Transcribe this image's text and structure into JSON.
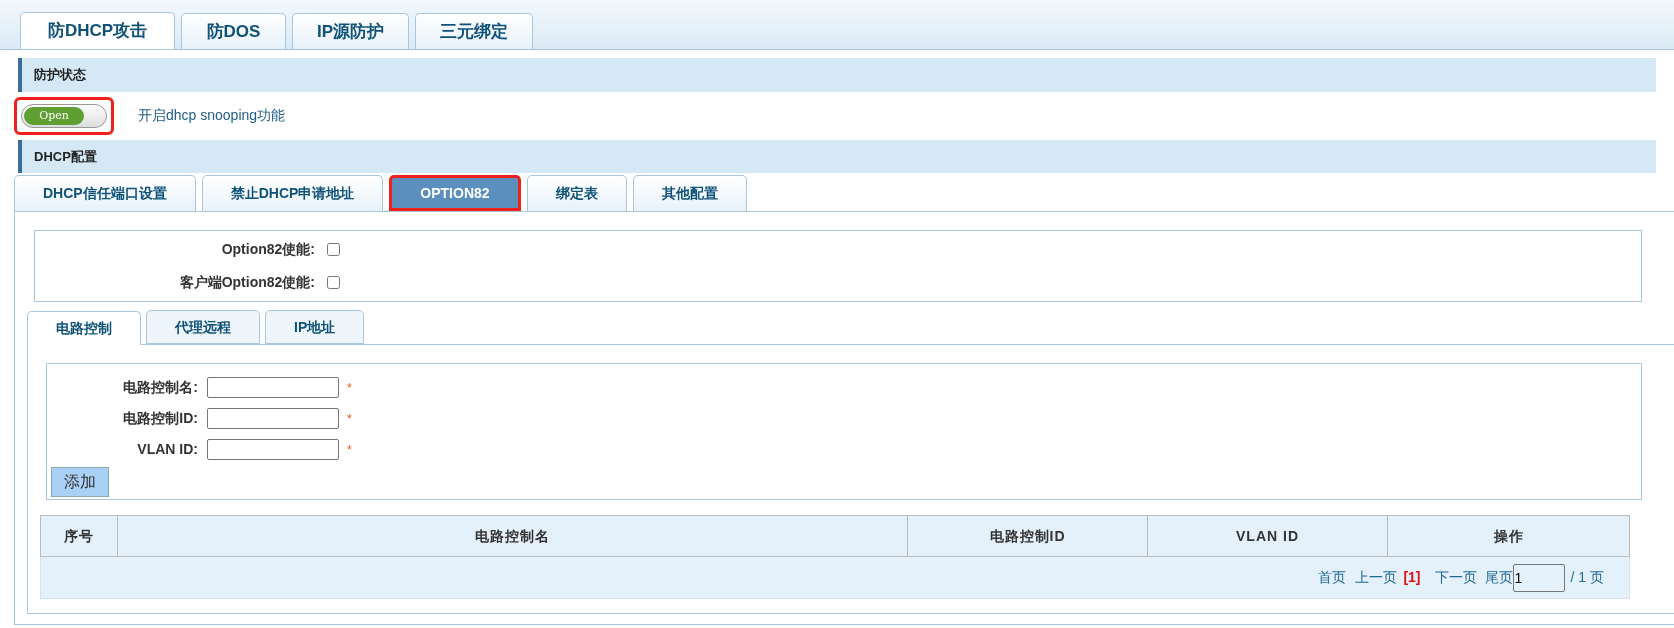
{
  "top_tabs": [
    {
      "label": "防DHCP攻击",
      "selected": true
    },
    {
      "label": "防DOS",
      "selected": false
    },
    {
      "label": "IP源防护",
      "selected": false
    },
    {
      "label": "三元绑定",
      "selected": false
    }
  ],
  "status_section": {
    "title": "防护状态",
    "switch": {
      "label": "Open",
      "on": true,
      "highlighted": true
    },
    "description": "开启dhcp snooping功能"
  },
  "config_section": {
    "title": "DHCP配置"
  },
  "config_tabs": [
    {
      "label": "DHCP信任端口设置",
      "selected": false,
      "highlighted": false
    },
    {
      "label": "禁止DHCP申请地址",
      "selected": false,
      "highlighted": false
    },
    {
      "label": "OPTION82",
      "selected": true,
      "highlighted": true
    },
    {
      "label": "绑定表",
      "selected": false,
      "highlighted": false
    },
    {
      "label": "其他配置",
      "selected": false,
      "highlighted": false
    }
  ],
  "options": [
    {
      "label": "Option82使能:",
      "checked": false
    },
    {
      "label": "客户端Option82使能:",
      "checked": false
    }
  ],
  "sub_tabs": [
    {
      "label": "电路控制",
      "selected": true
    },
    {
      "label": "代理远程",
      "selected": false
    },
    {
      "label": "IP地址",
      "selected": false
    }
  ],
  "form": {
    "fields": [
      {
        "label": "电路控制名:",
        "required_mark": "*"
      },
      {
        "label": "电路控制ID:",
        "required_mark": "*"
      },
      {
        "label": "VLAN ID:",
        "required_mark": "*"
      }
    ],
    "add_button": "添加"
  },
  "table": {
    "columns": [
      "序号",
      "电路控制名",
      "电路控制ID",
      "VLAN ID",
      "操作"
    ]
  },
  "pagination": {
    "first": "首页",
    "prev": "上一页",
    "current": "[1]",
    "next": "下一页",
    "last": "尾页",
    "page_input": "1",
    "total": "/ 1 页"
  }
}
